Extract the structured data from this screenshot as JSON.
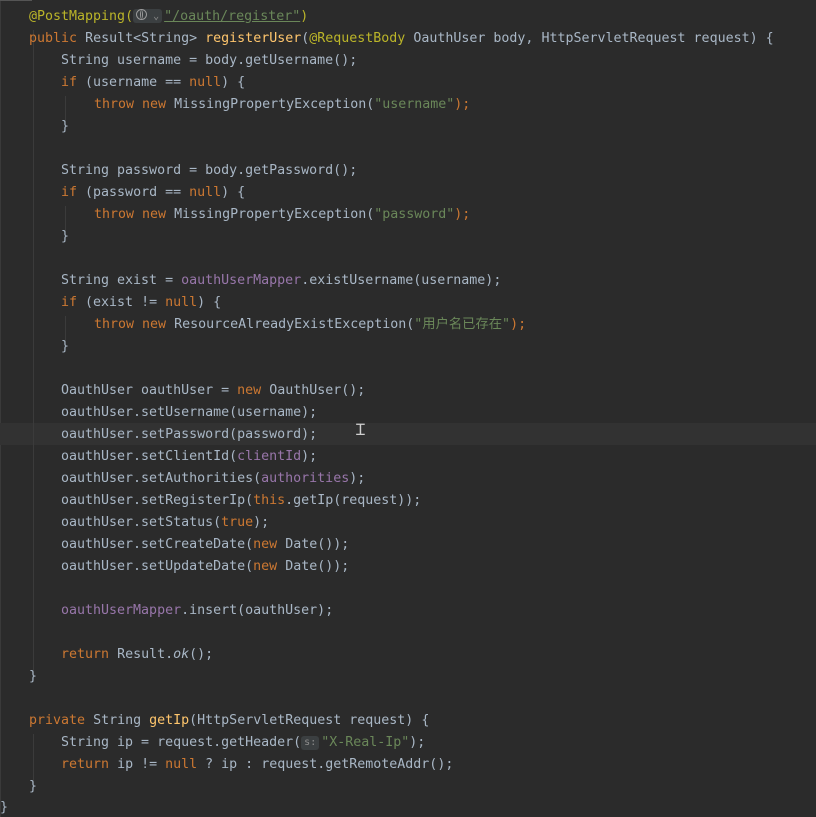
{
  "editor": {
    "theme_colors": {
      "background": "#2b2b2b",
      "keyword": "#cc7832",
      "string": "#6a8759",
      "annotation": "#bbb529",
      "method_decl": "#ffc66d",
      "field": "#9876aa",
      "text": "#a9b7c6",
      "caret_row": "#323232"
    },
    "inlay_hint_key": "s:",
    "code_lines": [
      [
        "@PostMapping(",
        "\"/oauth/register\"",
        ")"
      ],
      [
        "public",
        "Result<String>",
        "registerUser",
        "(",
        "@RequestBody",
        "OauthUser body,",
        "HttpServletRequest request) {"
      ],
      [
        "String username = body.getUsername();"
      ],
      [
        "if",
        "(username ==",
        "null",
        ") {"
      ],
      [
        "throw",
        "new",
        "MissingPropertyException(",
        "\"username\"",
        ");"
      ],
      [
        "}"
      ],
      [
        "String password = body.getPassword();"
      ],
      [
        "if",
        "(password ==",
        "null",
        ") {"
      ],
      [
        "throw",
        "new",
        "MissingPropertyException(",
        "\"password\"",
        ");"
      ],
      [
        "}"
      ],
      [
        "String exist =",
        "oauthUserMapper",
        ".existUsername(username);"
      ],
      [
        "if",
        "(exist !=",
        "null",
        ") {"
      ],
      [
        "throw",
        "new",
        "ResourceAlreadyExistException(",
        "\"用户名已存在\"",
        ");"
      ],
      [
        "}"
      ],
      [
        "OauthUser oauthUser =",
        "new",
        "OauthUser();"
      ],
      [
        "oauthUser.setUsername(username);"
      ],
      [
        "oauthUser.setPassword(password);"
      ],
      [
        "oauthUser.setClientId(",
        "clientId",
        ");"
      ],
      [
        "oauthUser.setAuthorities(",
        "authorities",
        ");"
      ],
      [
        "oauthUser.setRegisterIp(",
        "this",
        ".getIp(request));"
      ],
      [
        "oauthUser.setStatus(",
        "true",
        ");"
      ],
      [
        "oauthUser.setCreateDate(",
        "new",
        "Date());"
      ],
      [
        "oauthUser.setUpdateDate(",
        "new",
        "Date());"
      ],
      [
        "oauthUserMapper",
        ".insert(oauthUser);"
      ],
      [
        "return",
        "Result.",
        "ok",
        "();"
      ],
      [
        "}"
      ],
      [
        "private",
        "String",
        "getIp",
        "(HttpServletRequest request) {"
      ],
      [
        "String ip = request.getHeader(",
        "\"X-Real-Ip\"",
        ");"
      ],
      [
        "return",
        "ip !=",
        "null",
        "? ip : request.getRemoteAddr();"
      ],
      [
        "}"
      ],
      [
        "}"
      ]
    ]
  }
}
